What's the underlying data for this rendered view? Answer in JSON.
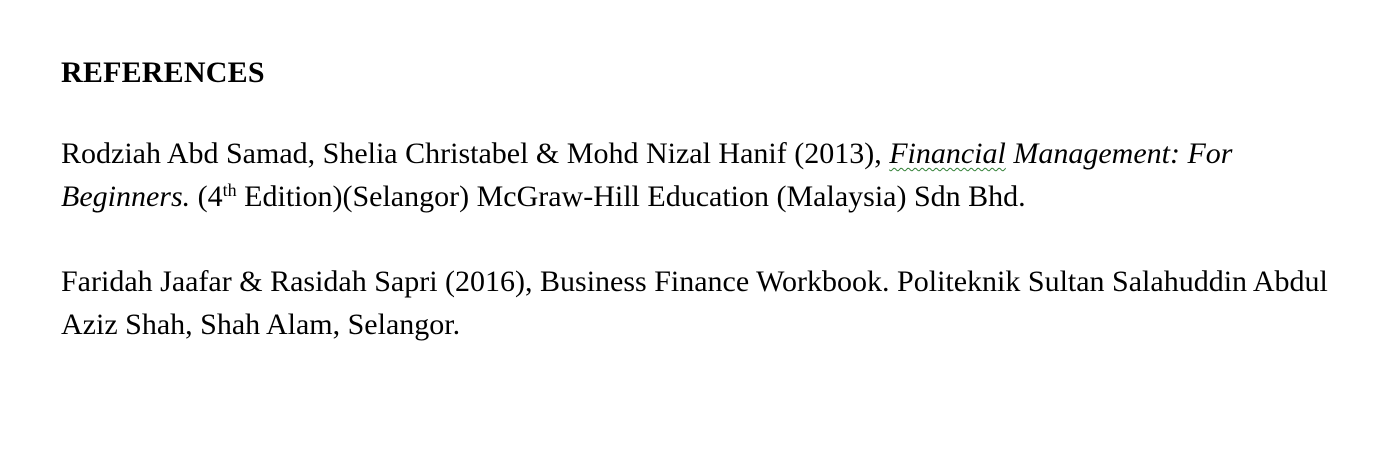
{
  "document": {
    "heading": "REFERENCES",
    "references": [
      {
        "authors_year": "Rodziah Abd Samad, Shelia  Christabel & Mohd Nizal Hanif (2013), ",
        "title_part1": "Financial",
        "title_part2": " Management: For Beginners.",
        "edition_prefix": " (4",
        "edition_sup": "th",
        "edition_rest": " Edition)(Selangor) McGraw-Hill Education (Malaysia)  Sdn Bhd."
      },
      {
        "text": "Faridah Jaafar & Rasidah Sapri (2016), Business Finance Workbook. Politeknik Sultan Salahuddin Abdul Aziz Shah, Shah Alam,  Selangor."
      }
    ]
  }
}
